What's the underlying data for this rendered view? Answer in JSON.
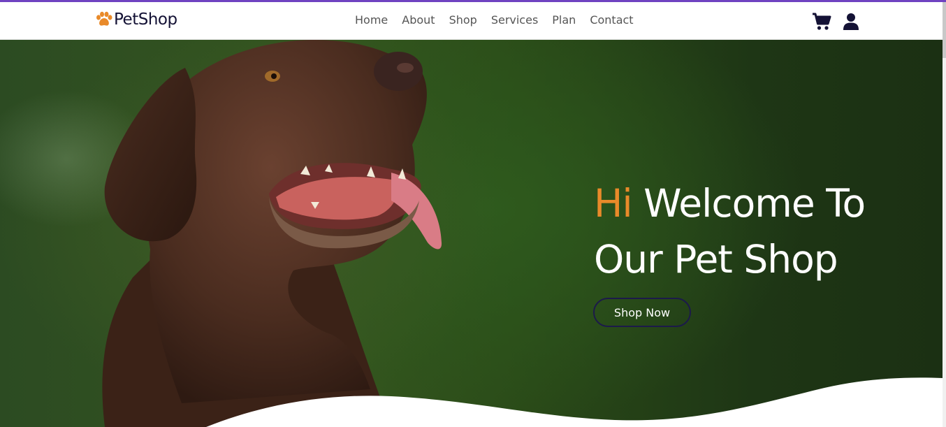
{
  "brand": {
    "name": "PetShop",
    "icon": "paw-icon",
    "icon_color": "#e98a2a"
  },
  "nav": {
    "items": [
      {
        "label": "Home"
      },
      {
        "label": "About"
      },
      {
        "label": "Shop"
      },
      {
        "label": "Services"
      },
      {
        "label": "Plan"
      },
      {
        "label": "Contact"
      }
    ],
    "icons": [
      "cart-icon",
      "user-icon"
    ]
  },
  "hero": {
    "headline_accent": "Hi",
    "headline_line1": "Welcome To",
    "headline_line2": "Our Pet Shop",
    "cta_label": "Shop Now"
  },
  "colors": {
    "accent": "#e98a2a",
    "top_bar": "#6f42c1",
    "dark": "#141235"
  }
}
